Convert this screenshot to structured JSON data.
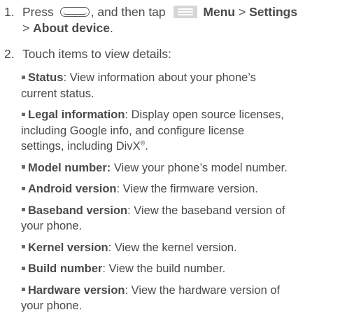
{
  "step1": {
    "number": "1.",
    "press": "Press",
    "then_tap": ", and then tap",
    "menu": "Menu",
    "sep1": " > ",
    "settings": "Settings",
    "sep2": "> ",
    "about": "About device",
    "period": "."
  },
  "step2": {
    "number": "2.",
    "text": "Touch items to view details:"
  },
  "items": [
    {
      "term": "Status",
      "desc_l1": ": View information about your phone’s",
      "desc_l2": "current status."
    },
    {
      "term": "Legal information",
      "desc_l1": ": Display open source licenses,",
      "desc_l2": "including Google info, and configure license",
      "desc_l3": "settings, including DivX",
      "reg": "®",
      "end": "."
    },
    {
      "term": "Model number:",
      "desc_l1": " View your phone’s model number."
    },
    {
      "term": "Android version",
      "desc_l1": ": View the firmware version."
    },
    {
      "term": "Baseband version",
      "desc_l1": ": View the baseband version of",
      "desc_l2": "your phone."
    },
    {
      "term": "Kernel version",
      "desc_l1": ": View the kernel version."
    },
    {
      "term": "Build number",
      "desc_l1": ": View the build number."
    },
    {
      "term": "Hardware version",
      "desc_l1": ": View the hardware version of",
      "desc_l2": "your phone."
    }
  ]
}
